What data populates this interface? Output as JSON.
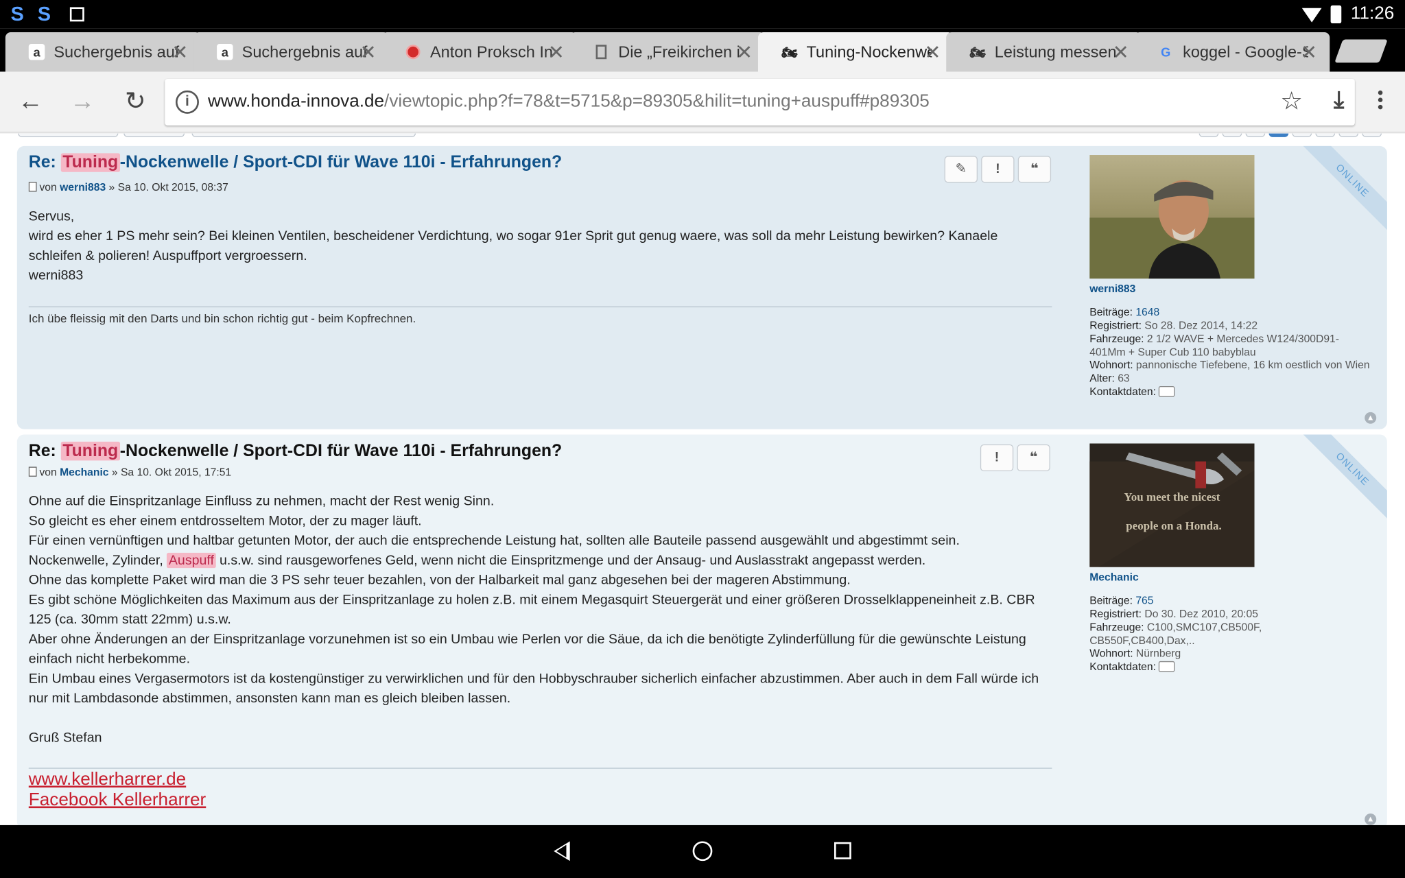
{
  "status": {
    "time": "11:26"
  },
  "tabs": [
    {
      "label": "Suchergebnis auf",
      "favicon": "amazon-icon"
    },
    {
      "label": "Suchergebnis auf",
      "favicon": "amazon-icon"
    },
    {
      "label": "Anton Proksch In",
      "favicon": "red-dot-icon"
    },
    {
      "label": "Die „Freikirchen i",
      "favicon": "document-icon"
    },
    {
      "label": "Tuning-Nockenwe",
      "favicon": "motorbike-icon",
      "active": true
    },
    {
      "label": "Leistung messen",
      "favicon": "motorbike-icon"
    },
    {
      "label": "koggel - Google-S",
      "favicon": "google-icon"
    }
  ],
  "toolbar": {
    "url_host": "www.honda-innova.de",
    "url_path": "/viewtopic.php?f=78&t=5715&p=89305&hilit=tuning+auspuff#p89305"
  },
  "posts": [
    {
      "title_prefix": "Re: ",
      "title_hl": "Tuning",
      "title_rest": "-Nockenwelle / Sport-CDI für Wave 110i - Erfahrungen?",
      "meta_by": "von ",
      "author": "werni883",
      "meta_date": " » Sa 10. Okt 2015, 08:37",
      "body": [
        "Servus,",
        "wird es eher 1 PS mehr sein? Bei kleinen Ventilen, bescheidener Verdichtung, wo sogar 91er Sprit gut genug waere, was soll da mehr Leistung bewirken? Kanaele schleifen & polieren! Auspuffport vergroessern.",
        "werni883"
      ],
      "signature": "Ich übe fleissig mit den Darts und bin schon richtig gut - beim Kopfrechnen.",
      "profile": {
        "username": "werni883",
        "beitraege_label": "Beiträge:",
        "beitraege": "1648",
        "registriert_label": "Registriert:",
        "registriert": "So 28. Dez 2014, 14:22",
        "fahrzeuge_label": "Fahrzeuge:",
        "fahrzeuge": "2 1/2 WAVE + Mercedes W124/300D91-401Mm + Super Cub 110 babyblau",
        "wohnort_label": "Wohnort:",
        "wohnort": "pannonische Tiefebene, 16 km oestlich von Wien",
        "alter_label": "Alter:",
        "alter": "63",
        "kontakt_label": "Kontaktdaten:"
      },
      "online": "ONLINE"
    },
    {
      "title_prefix": "Re: ",
      "title_hl": "Tuning",
      "title_rest": "-Nockenwelle / Sport-CDI für Wave 110i - Erfahrungen?",
      "meta_by": "von ",
      "author": "Mechanic",
      "meta_date": " » Sa 10. Okt 2015, 17:51",
      "body": [
        "Ohne auf die Einspritzanlage Einfluss zu nehmen, macht der Rest wenig Sinn.",
        "So gleicht es eher einem entdrosseltem Motor, der zu mager läuft.",
        "Für einen vernünftigen und haltbar getunten Motor, der auch die entsprechende Leistung hat, sollten alle Bauteile passend ausgewählt und abgestimmt sein.",
        "Nockenwelle, Zylinder, ",
        "Auspuff",
        " u.s.w. sind rausgeworfenes Geld, wenn nicht die Einspritzmenge und der Ansaug- und Auslasstrakt angepasst werden.",
        "Ohne das komplette Paket wird man die 3 PS sehr teuer bezahlen, von der Halbarkeit mal ganz abgesehen bei der mageren Abstimmung.",
        "Es gibt schöne Möglichkeiten das Maximum aus der Einspritzanlage zu holen z.B. mit einem Megasquirt Steuergerät und einer größeren Drosselklappeneinheit z.B. CBR 125 (ca. 30mm statt 22mm) u.s.w.",
        "Aber ohne Änderungen an der Einspritzanlage vorzunehmen ist so ein Umbau wie Perlen vor die Säue, da ich die benötigte Zylinderfüllung für die gewünschte Leistung einfach nicht herbekomme.",
        "Ein Umbau eines Vergasermotors ist da kostengünstiger zu verwirklichen und für den Hobbyschrauber sicherlich einfacher abzustimmen. Aber auch in dem Fall würde ich nur mit Lambdasonde abstimmen, ansonsten kann man es gleich bleiben lassen.",
        "Gruß Stefan"
      ],
      "links": [
        "www.kellerharrer.de",
        "Facebook Kellerharrer"
      ],
      "avatar_text": [
        "You meet the nicest",
        "people on a Honda."
      ],
      "profile": {
        "username": "Mechanic",
        "beitraege_label": "Beiträge:",
        "beitraege": "765",
        "registriert_label": "Registriert:",
        "registriert": "Do 30. Dez 2010, 20:05",
        "fahrzeuge_label": "Fahrzeuge:",
        "fahrzeuge": "C100,SMC107,CB500F, CB550F,CB400,Dax,..",
        "wohnort_label": "Wohnort:",
        "wohnort": "Nürnberg",
        "kontakt_label": "Kontaktdaten:"
      },
      "online": "ONLINE"
    }
  ],
  "colors": {
    "link_blue": "#105289",
    "highlight_bg": "#f5b8c6",
    "highlight_text": "#bc2a4d",
    "post1_bg": "#e1ebf2",
    "post2_bg": "#ecf3f7",
    "signature_link": "#c81e2e"
  }
}
